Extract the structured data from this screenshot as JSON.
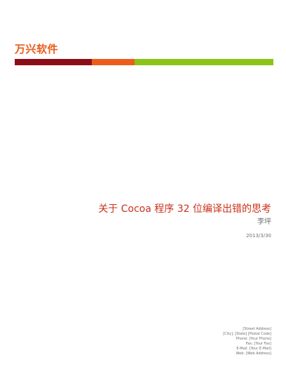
{
  "header": {
    "company_name": "万兴软件"
  },
  "accent_colors": {
    "dark_red": "#8b0f17",
    "orange": "#ee5c1c",
    "green": "#8cc317"
  },
  "cover": {
    "title": "关于 Cocoa 程序 32 位编译出错的思考",
    "author": "李坪",
    "date": "2013/3/30"
  },
  "contact": {
    "street": "[Street Address]",
    "city_state_zip": "[City], [State] [Postal Code]",
    "phone": "Phone: [Your Phone]",
    "fax": "Fax: [Your Fax]",
    "email": "E-Mail: [Your E-Mail]",
    "web": "Web: [Web Address]"
  }
}
